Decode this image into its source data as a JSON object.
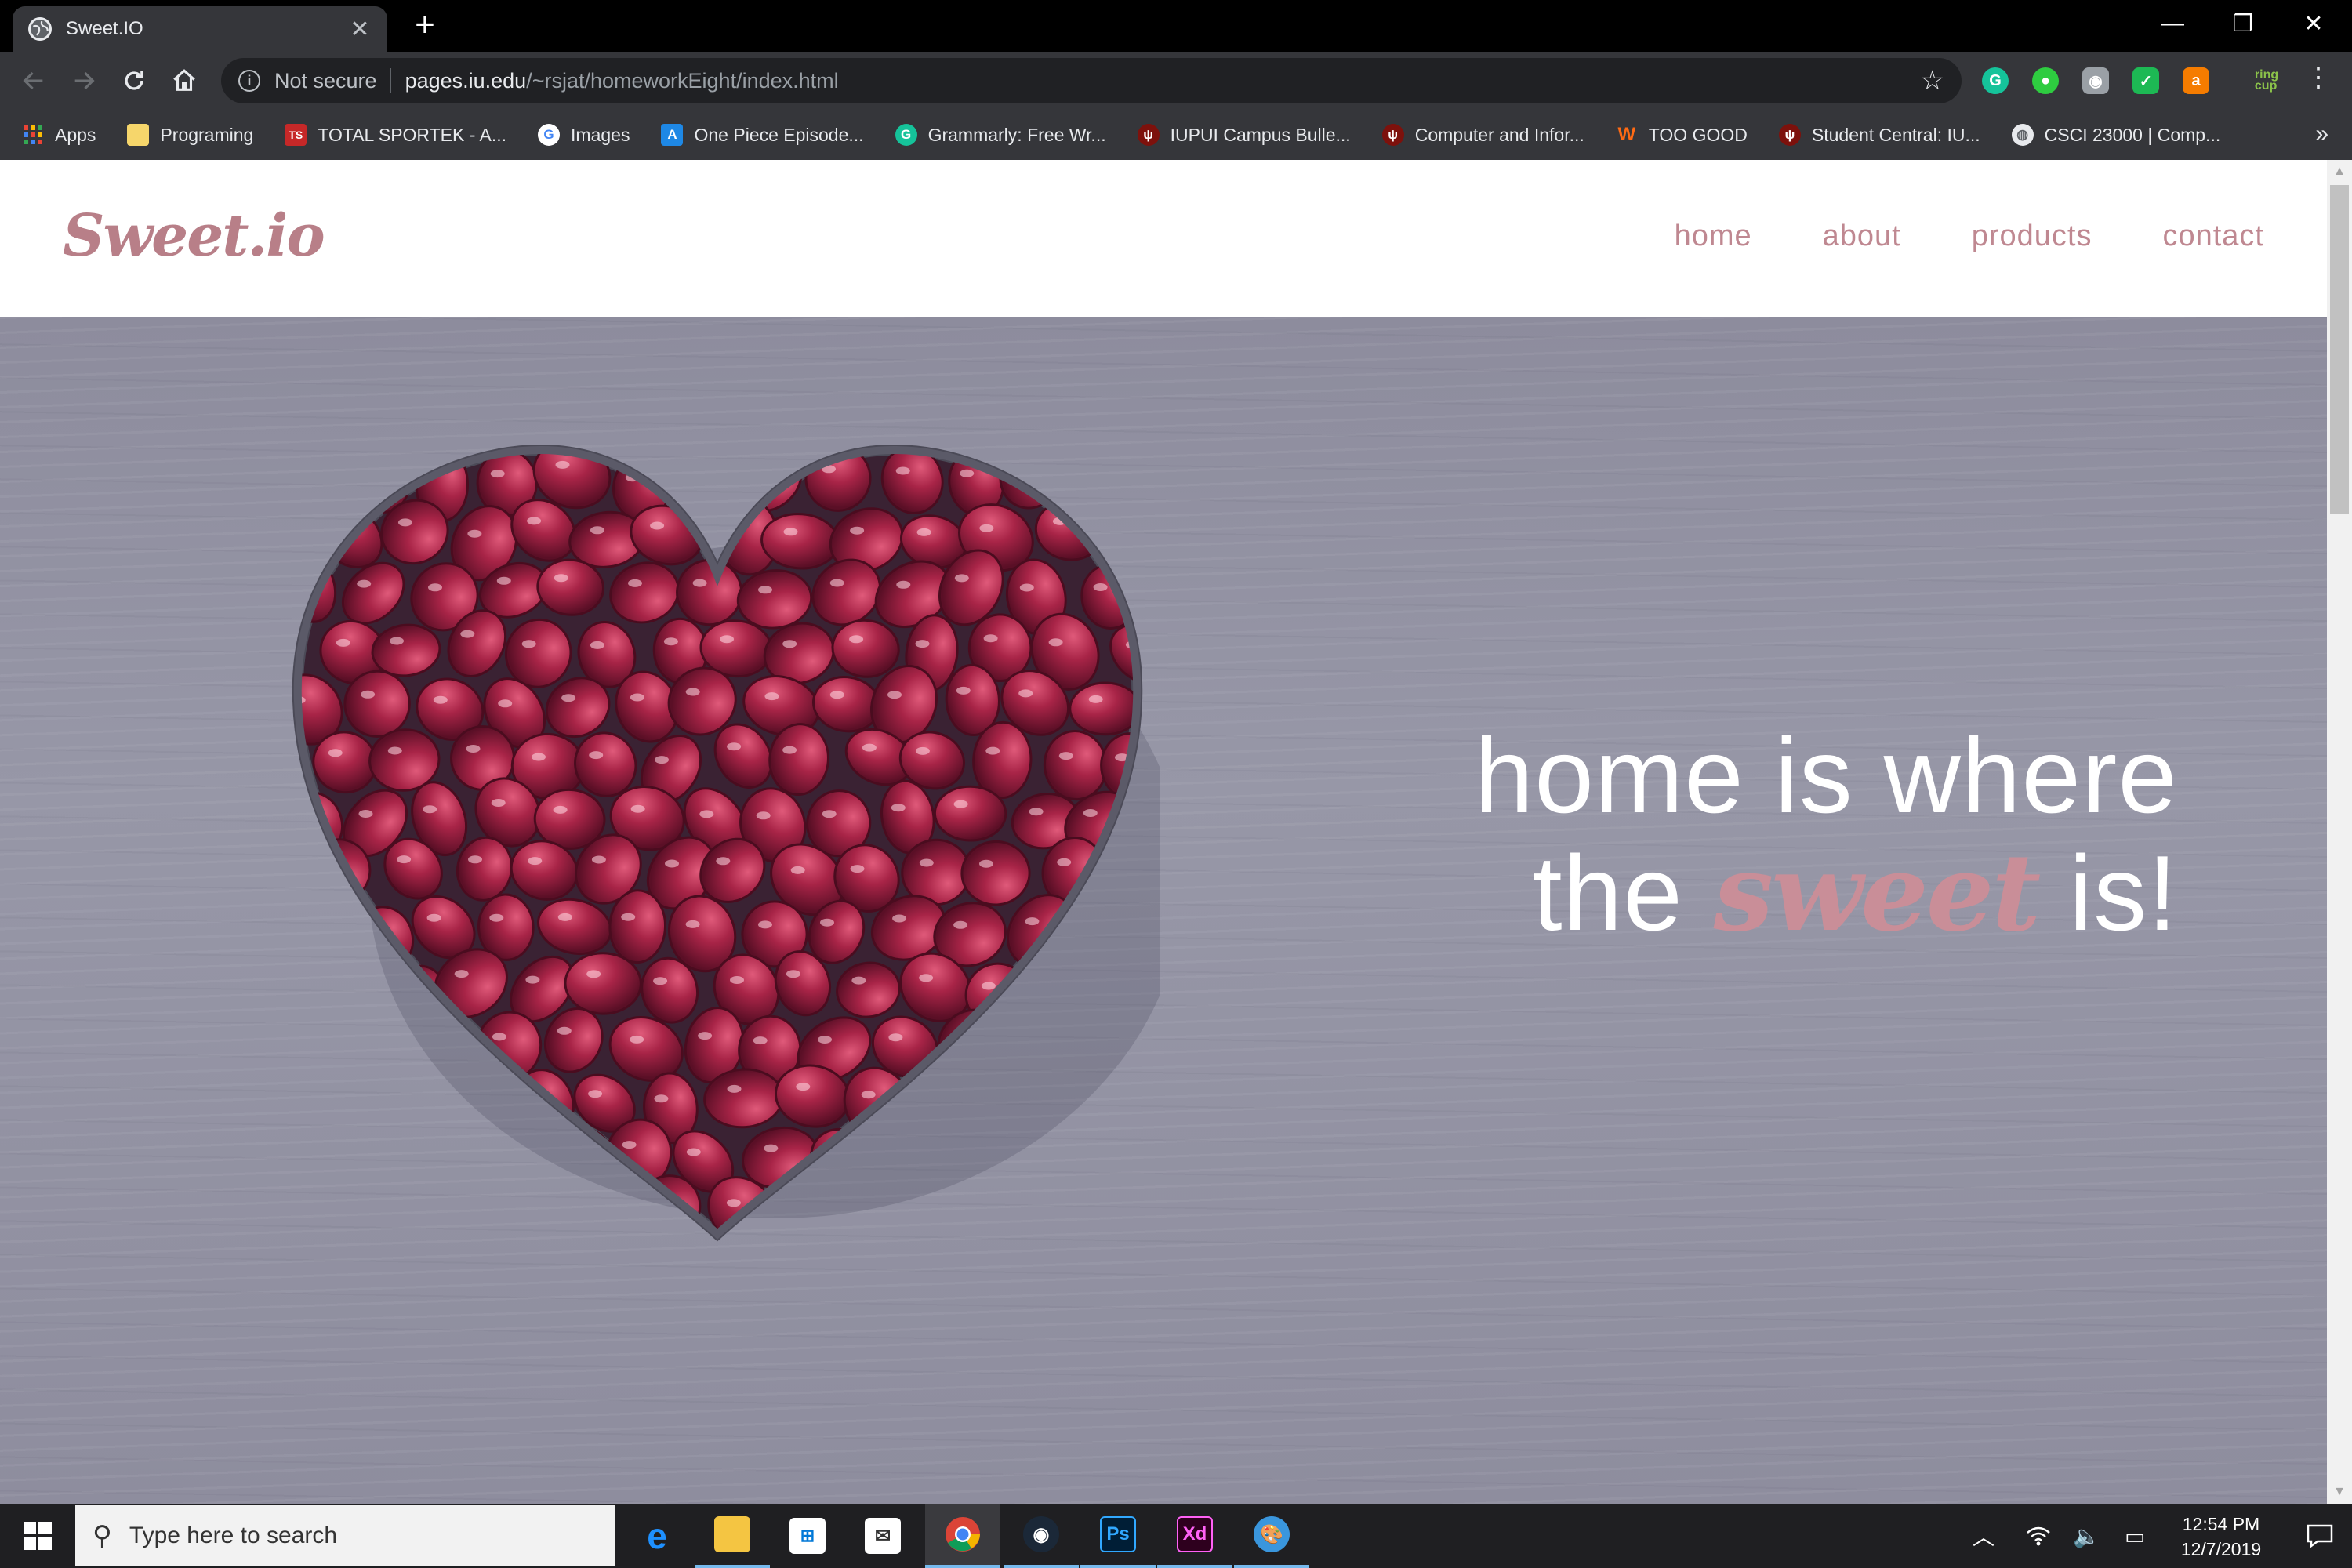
{
  "browser": {
    "tab_title": "Sweet.IO",
    "tab_close": "✕",
    "new_tab": "+",
    "window_minimize": "—",
    "window_restore": "❐",
    "window_close": "✕",
    "address": {
      "security_label": "Not secure",
      "url_host": "pages.iu.edu",
      "url_path": "/~rsjat/homeworkEight/index.html"
    },
    "bookmarks": [
      {
        "label": "Apps",
        "icon": "apps-grid-icon",
        "color": "#4285f4"
      },
      {
        "label": "Programing",
        "icon": "folder-icon",
        "color": "#f6c94c"
      },
      {
        "label": "TOTAL SPORTEK - A...",
        "icon": "ts-icon",
        "color": "#c62828"
      },
      {
        "label": "Images",
        "icon": "google-icon",
        "color": "#ffffff"
      },
      {
        "label": "One Piece Episode...",
        "icon": "letter-a-icon",
        "color": "#1e88e5"
      },
      {
        "label": "Grammarly: Free Wr...",
        "icon": "grammarly-icon",
        "color": "#15c39a"
      },
      {
        "label": "IUPUI Campus Bulle...",
        "icon": "iu-trident-icon",
        "color": "#7d110c"
      },
      {
        "label": "Computer and Infor...",
        "icon": "iu-trident-icon",
        "color": "#7d110c"
      },
      {
        "label": "TOO GOOD",
        "icon": "w-logo-icon",
        "color": "#ff6a13"
      },
      {
        "label": "Student Central: IU...",
        "icon": "iu-trident-icon",
        "color": "#7d110c"
      },
      {
        "label": "CSCI 23000 | Comp...",
        "icon": "globe-icon",
        "color": "#e8eaed"
      }
    ],
    "bookmarks_more": "»"
  },
  "site": {
    "logo": "Sweet.io",
    "nav": [
      "home",
      "about",
      "products",
      "contact"
    ],
    "hero": {
      "line1": "home is where",
      "line2_start": "the",
      "line2_emphasis": "sweet",
      "line2_end": "is!"
    },
    "accent_color": "#c98e98"
  },
  "taskbar": {
    "search_placeholder": "Type here to search",
    "time": "12:54 PM",
    "date": "12/7/2019"
  }
}
